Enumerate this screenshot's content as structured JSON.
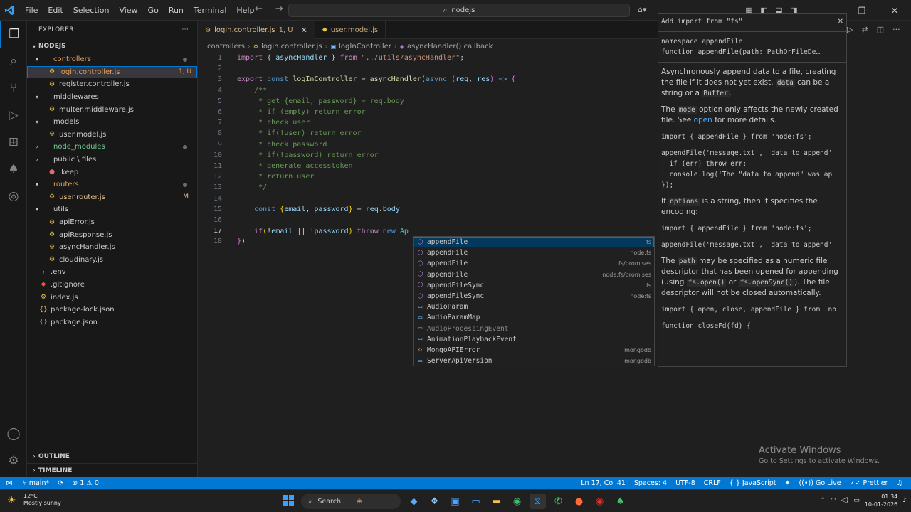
{
  "titlebar": {
    "menu": [
      "File",
      "Edit",
      "Selection",
      "View",
      "Go",
      "Run",
      "Terminal",
      "Help"
    ],
    "search": "nodejs"
  },
  "sidebar": {
    "header": "EXPLORER",
    "root": "NODEJS",
    "tree": [
      {
        "label": "controllers",
        "type": "folder-open",
        "depth": 1,
        "color": "orange",
        "dot": true
      },
      {
        "label": "login.controller.js",
        "type": "js",
        "depth": 2,
        "badge": "1, U",
        "color": "orange",
        "active": true
      },
      {
        "label": "register.controller.js",
        "type": "js",
        "depth": 2
      },
      {
        "label": "middlewares",
        "type": "folder-open",
        "depth": 1
      },
      {
        "label": "multer.middleware.js",
        "type": "js",
        "depth": 2
      },
      {
        "label": "models",
        "type": "folder-open",
        "depth": 1
      },
      {
        "label": "user.model.js",
        "type": "js",
        "depth": 2
      },
      {
        "label": "node_modules",
        "type": "folder",
        "depth": 1,
        "color": "green",
        "dot": true
      },
      {
        "label": "public \\ files",
        "type": "folder",
        "depth": 1
      },
      {
        "label": ".keep",
        "type": "keep",
        "depth": 2
      },
      {
        "label": "routers",
        "type": "folder-open",
        "depth": 1,
        "color": "orange",
        "dot": true
      },
      {
        "label": "user.router.js",
        "type": "js",
        "depth": 2,
        "badge": "M",
        "color": "yellow"
      },
      {
        "label": "utils",
        "type": "folder-open",
        "depth": 1
      },
      {
        "label": "apiError.js",
        "type": "js",
        "depth": 2
      },
      {
        "label": "apiResponse.js",
        "type": "js",
        "depth": 2
      },
      {
        "label": "asyncHandler.js",
        "type": "js",
        "depth": 2
      },
      {
        "label": "cloudinary.js",
        "type": "js",
        "depth": 2
      },
      {
        "label": ".env",
        "type": "env",
        "depth": 1
      },
      {
        "label": ".gitignore",
        "type": "git",
        "depth": 1
      },
      {
        "label": "index.js",
        "type": "js",
        "depth": 1
      },
      {
        "label": "package-lock.json",
        "type": "json",
        "depth": 1
      },
      {
        "label": "package.json",
        "type": "json",
        "depth": 1
      }
    ],
    "outline": "OUTLINE",
    "timeline": "TIMELINE"
  },
  "tabs": [
    {
      "label": "login.controller.js",
      "suffix": "1, U",
      "active": true
    },
    {
      "label": "user.model.js",
      "active": false
    }
  ],
  "breadcrumb": [
    "controllers",
    "login.controller.js",
    "logInController",
    "asyncHandler() callback"
  ],
  "editor": {
    "current_line": 17,
    "lines": [
      {
        "n": "1",
        "tokens": [
          [
            "kw",
            "import "
          ],
          [
            "pun",
            "{ "
          ],
          [
            "var",
            "asyncHandler"
          ],
          [
            "pun",
            " } "
          ],
          [
            "kw",
            "from "
          ],
          [
            "str",
            "\"../utils/asyncHandler\""
          ],
          [
            "pun",
            ";"
          ]
        ]
      },
      {
        "n": "2",
        "tokens": []
      },
      {
        "n": "3",
        "tokens": [
          [
            "kw",
            "export "
          ],
          [
            "kw2",
            "const "
          ],
          [
            "fn",
            "logInController"
          ],
          [
            "pun",
            " = "
          ],
          [
            "fn",
            "asyncHandler"
          ],
          [
            "brk",
            "("
          ],
          [
            "kw2",
            "async "
          ],
          [
            "brk2",
            "("
          ],
          [
            "var",
            "req"
          ],
          [
            "pun",
            ", "
          ],
          [
            "var",
            "res"
          ],
          [
            "brk2",
            ")"
          ],
          [
            "kw2",
            " => "
          ],
          [
            "brk2",
            "{"
          ]
        ]
      },
      {
        "n": "4",
        "tokens": [
          [
            "cmt",
            "    /**"
          ]
        ]
      },
      {
        "n": "5",
        "tokens": [
          [
            "cmt",
            "     * get {email, password} = req.body"
          ]
        ]
      },
      {
        "n": "6",
        "tokens": [
          [
            "cmt",
            "     * if (empty) return error"
          ]
        ]
      },
      {
        "n": "7",
        "tokens": [
          [
            "cmt",
            "     * check user"
          ]
        ]
      },
      {
        "n": "8",
        "tokens": [
          [
            "cmt",
            "     * if(!user) return error"
          ]
        ]
      },
      {
        "n": "9",
        "tokens": [
          [
            "cmt",
            "     * check password"
          ]
        ]
      },
      {
        "n": "10",
        "tokens": [
          [
            "cmt",
            "     * if(!password) return error"
          ]
        ]
      },
      {
        "n": "11",
        "tokens": [
          [
            "cmt",
            "     * generate accesstoken"
          ]
        ]
      },
      {
        "n": "12",
        "tokens": [
          [
            "cmt",
            "     * return user"
          ]
        ]
      },
      {
        "n": "13",
        "tokens": [
          [
            "cmt",
            "     */"
          ]
        ]
      },
      {
        "n": "14",
        "tokens": []
      },
      {
        "n": "15",
        "tokens": [
          [
            "kw2",
            "    const "
          ],
          [
            "brk",
            "{"
          ],
          [
            "var",
            "email"
          ],
          [
            "pun",
            ", "
          ],
          [
            "var",
            "password"
          ],
          [
            "brk",
            "}"
          ],
          [
            "pun",
            " = "
          ],
          [
            "var",
            "req"
          ],
          [
            "pun",
            "."
          ],
          [
            "var",
            "body"
          ]
        ]
      },
      {
        "n": "16",
        "tokens": []
      },
      {
        "n": "17",
        "tokens": [
          [
            "kw",
            "    if"
          ],
          [
            "brk",
            "("
          ],
          [
            "pun",
            "!"
          ],
          [
            "var",
            "email"
          ],
          [
            "pun",
            " || "
          ],
          [
            "pun",
            "!"
          ],
          [
            "var",
            "password"
          ],
          [
            "brk",
            ")"
          ],
          [
            "kw",
            " throw "
          ],
          [
            "kw2",
            "new "
          ],
          [
            "cls",
            "Ap"
          ]
        ]
      },
      {
        "n": "18",
        "tokens": [
          [
            "brk2",
            "}"
          ],
          [
            "brk",
            ")"
          ]
        ]
      }
    ]
  },
  "suggestions": [
    {
      "label": "appendFile",
      "match": "ap",
      "detail": "fs",
      "kind": "method",
      "selected": true
    },
    {
      "label": "appendFile",
      "match": "ap",
      "detail": "node:fs",
      "kind": "method"
    },
    {
      "label": "appendFile",
      "match": "ap",
      "detail": "fs/promises",
      "kind": "method"
    },
    {
      "label": "appendFile",
      "match": "ap",
      "detail": "node:fs/promises",
      "kind": "method"
    },
    {
      "label": "appendFileSync",
      "match": "ap",
      "detail": "fs",
      "kind": "method"
    },
    {
      "label": "appendFileSync",
      "match": "ap",
      "detail": "node:fs",
      "kind": "method"
    },
    {
      "label": "AudioParam",
      "match": "A",
      "detail": "",
      "kind": "var"
    },
    {
      "label": "AudioParamMap",
      "match": "A",
      "detail": "",
      "kind": "var"
    },
    {
      "label": "AudioProcessingEvent",
      "match": "A",
      "detail": "",
      "kind": "var",
      "deprecated": true
    },
    {
      "label": "AnimationPlaybackEvent",
      "match": "A",
      "detail": "",
      "kind": "var"
    },
    {
      "label": "MongoAPIError",
      "match": "",
      "detail": "mongodb",
      "kind": "class"
    },
    {
      "label": "ServerApiVersion",
      "match": "",
      "detail": "mongodb",
      "kind": "var"
    }
  ],
  "docs": {
    "header": "Add import from \"fs\"",
    "signature_1": "namespace appendFile",
    "signature_2": "function appendFile(path: PathOrFileDe…",
    "p1_a": "Asynchronously append data to a file, creating the file if it does not yet exist. ",
    "p1_code": "data",
    "p1_b": " can be a string or a ",
    "p1_code2": "Buffer",
    "p1_c": ".",
    "p2_a": "The ",
    "p2_code": "mode",
    "p2_b": " option only affects the newly created file. See ",
    "p2_link": "open",
    "p2_c": " for more details.",
    "c1": "import { appendFile } from 'node:fs';",
    "c2": "appendFile('message.txt', 'data to append'",
    "c3": "  if (err) throw err;",
    "c4": "  console.log('The \"data to append\" was ap",
    "c5": "});",
    "p3_a": "If ",
    "p3_code": "options",
    "p3_b": " is a string, then it specifies the encoding:",
    "c6": "import { appendFile } from 'node:fs';",
    "c7": "appendFile('message.txt', 'data to append'",
    "p4_a": "The ",
    "p4_code": "path",
    "p4_b": " may be specified as a numeric file descriptor that has been opened for appending (using ",
    "p4_code2": "fs.open()",
    "p4_c": " or ",
    "p4_code3": "fs.openSync()",
    "p4_d": "). The file descriptor will not be closed automatically.",
    "c8": "import { open, close, appendFile } from 'no",
    "c9": "function closeFd(fd) {"
  },
  "activate": {
    "title": "Activate Windows",
    "sub": "Go to Settings to activate Windows."
  },
  "statusbar": {
    "branch": "main*",
    "problems": "1",
    "warnings": "0",
    "position": "Ln 17, Col 41",
    "spaces": "Spaces: 4",
    "encoding": "UTF-8",
    "eol": "CRLF",
    "language": "JavaScript",
    "golive": "Go Live",
    "prettier": "Prettier"
  },
  "taskbar": {
    "temp": "12°C",
    "weather": "Mostly sunny",
    "search": "Search",
    "time": "01:34",
    "date": "10-01-2026"
  }
}
